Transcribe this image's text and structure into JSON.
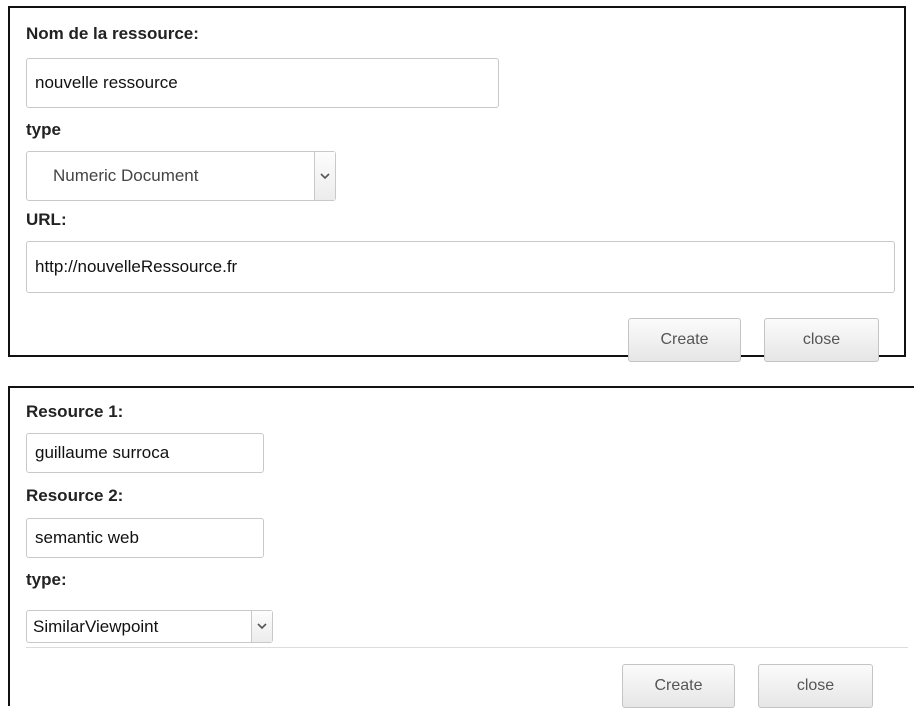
{
  "create_resource_dialog": {
    "name_label": "Nom de la ressource:",
    "name_value": "nouvelle ressource",
    "type_label": "type",
    "type_selected": "Numeric Document",
    "url_label": "URL:",
    "url_value": "http://nouvelleRessource.fr",
    "create_label": "Create",
    "close_label": "close"
  },
  "create_link_dialog": {
    "resource1_label": "Resource 1:",
    "resource1_value": "guillaume surroca",
    "resource2_label": "Resource 2:",
    "resource2_value": "semantic web",
    "type_label": "type:",
    "type_selected": "SimilarViewpoint",
    "create_label": "Create",
    "close_label": "close"
  },
  "icons": {
    "dropdown": "chevron-down-icon"
  }
}
